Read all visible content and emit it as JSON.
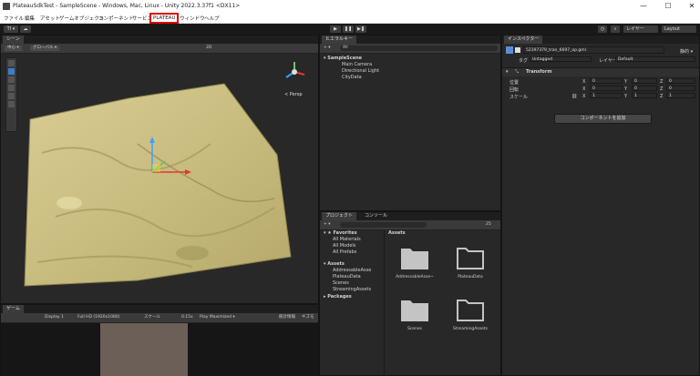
{
  "window": {
    "title": "PlateauSdkTest - SampleScene - Windows, Mac, Linux - Unity 2022.3.37f1 <DX11>",
    "controls": [
      "—",
      "☐",
      "✕"
    ]
  },
  "menubar": {
    "items": [
      "ファイル",
      "編集",
      "アセット",
      "ゲームオブジェクト",
      "コンポーネント",
      "サービス",
      "PLATEAU",
      "ウィンドウ",
      "ヘルプ"
    ]
  },
  "toolbar": {
    "account": "TI ▾",
    "layers": "レイヤー",
    "layout": "Layout"
  },
  "scene_panel": {
    "tab": "シーン",
    "persp": "< Persp",
    "center_btn": "中心 ▾",
    "global_btn": "グローバル ▾",
    "mode_2d": "2D"
  },
  "game_panel": {
    "tab": "ゲーム",
    "display": "Display 1",
    "resolution": "Full HD (1920x1080)",
    "scale_label": "スケール",
    "scale_value": "0.15x",
    "play_mode": "Play Maximized ▾",
    "stats": "統計情報",
    "gizmos": "ギズモ"
  },
  "hierarchy_panel": {
    "tab": "ヒエラルキー",
    "search_label": "All",
    "scene": "SampleScene",
    "objects": [
      "Main Camera",
      "Directional Light",
      "CityData"
    ]
  },
  "project_panel": {
    "tabs": [
      "プロジェクト",
      "コンソール"
    ],
    "count": "25",
    "favorites_label": "Favorites",
    "favorites": [
      "All Materials",
      "All Models",
      "All Prefabs"
    ],
    "assets_label": "Assets",
    "asset_folders": [
      "AddressableAsse",
      "PlateauData",
      "Scenes",
      "StreamingAssets"
    ],
    "packages_label": "Packages",
    "breadcrumb": "Assets",
    "grid_items": [
      "AddressableAsse~",
      "PlateauData",
      "Scenes",
      "StreamingAssets"
    ]
  },
  "inspector_panel": {
    "tab": "インスペクター",
    "object_name": "52397379_tran_6697_op.gml",
    "static_label": "静的 ▾",
    "tag_label": "タグ",
    "tag_value": "Untagged",
    "layer_label": "レイヤー",
    "layer_value": "Default",
    "component": "Transform",
    "rows": [
      {
        "label": "位置",
        "x": "0",
        "y": "0",
        "z": "0"
      },
      {
        "label": "回転",
        "x": "0",
        "y": "0",
        "z": "0"
      },
      {
        "label": "スケール",
        "x": "1",
        "y": "1",
        "z": "1"
      }
    ],
    "add_component": "コンポーネントを追加"
  }
}
